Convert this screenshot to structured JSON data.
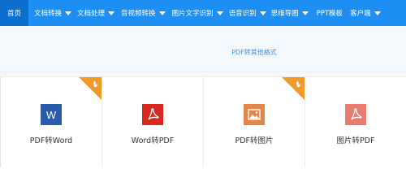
{
  "nav": {
    "items": [
      {
        "label": "首页",
        "dropdown": false
      },
      {
        "label": "文档转换",
        "dropdown": true
      },
      {
        "label": "文档处理",
        "dropdown": true
      },
      {
        "label": "音视频转换",
        "dropdown": true
      },
      {
        "label": "图片文字识别",
        "dropdown": true
      },
      {
        "label": "语音识别",
        "dropdown": true
      },
      {
        "label": "思维导图",
        "dropdown": true
      },
      {
        "label": "PPT模板",
        "dropdown": false
      },
      {
        "label": "客户端",
        "dropdown": true
      }
    ],
    "bg_color": "#1d8ef3",
    "active_color": "#0b6fd0"
  },
  "banner": {
    "link_text": "PDF转其他格式",
    "link_color": "#3a94e4"
  },
  "tools": [
    {
      "label": "PDF转Word",
      "icon": "word-icon",
      "hot": true
    },
    {
      "label": "Word转PDF",
      "icon": "pdf-icon",
      "hot": false
    },
    {
      "label": "PDF转图片",
      "icon": "image-icon",
      "hot": true
    },
    {
      "label": "图片转PDF",
      "icon": "image-to-pdf-icon",
      "hot": false
    }
  ],
  "colors": {
    "hot_badge": "#f29a27",
    "word_blue": "#2a5bab",
    "pdf_red": "#d62a21",
    "image_orange": "#e4854a",
    "image_to_pdf_orange": "#ea7b6f"
  }
}
